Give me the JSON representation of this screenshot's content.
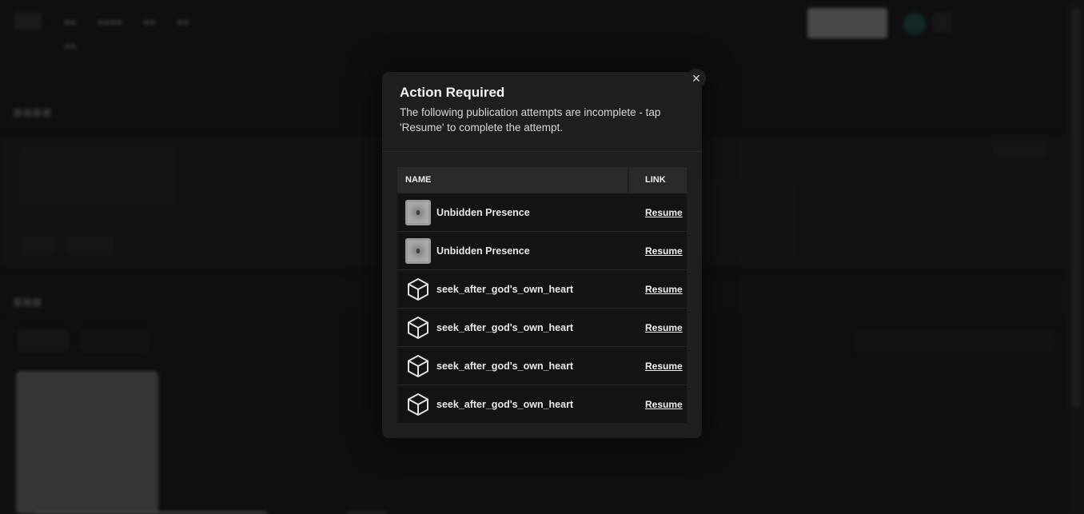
{
  "modal": {
    "title": "Action Required",
    "description": "The following publication attempts are incomplete - tap 'Resume' to complete the attempt.",
    "close_icon": "close-icon",
    "columns": {
      "name": "NAME",
      "link": "LINK"
    },
    "rows": [
      {
        "name": "Unbidden Presence",
        "thumb": "image",
        "link": "Resume"
      },
      {
        "name": "Unbidden Presence",
        "thumb": "image",
        "link": "Resume"
      },
      {
        "name": "seek_after_god's_own_heart",
        "thumb": "cube-icon",
        "link": "Resume"
      },
      {
        "name": "seek_after_god's_own_heart",
        "thumb": "cube-icon",
        "link": "Resume"
      },
      {
        "name": "seek_after_god's_own_heart",
        "thumb": "cube-icon",
        "link": "Resume"
      },
      {
        "name": "seek_after_god's_own_heart",
        "thumb": "cube-icon",
        "link": "Resume"
      }
    ]
  }
}
